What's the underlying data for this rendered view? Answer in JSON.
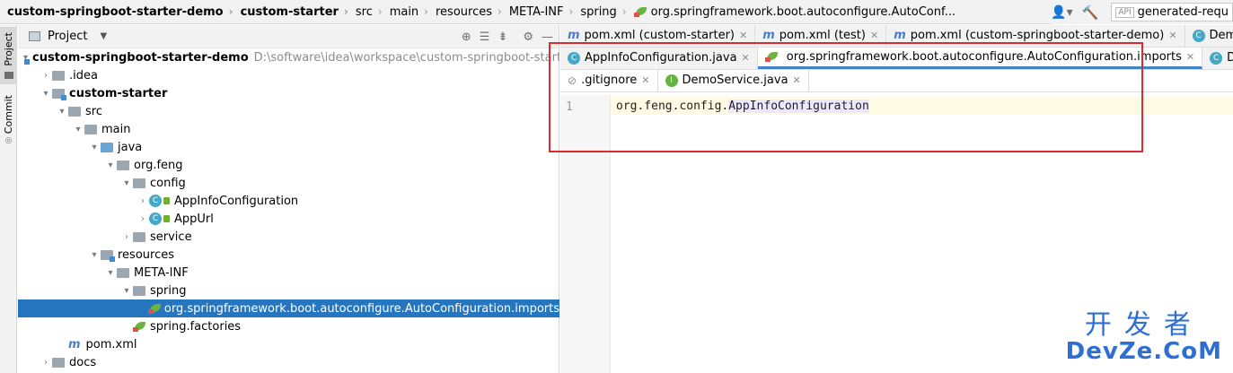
{
  "breadcrumb": [
    "custom-springboot-starter-demo",
    "custom-starter",
    "src",
    "main",
    "resources",
    "META-INF",
    "spring",
    "org.springframework.boot.autoconfigure.AutoConf..."
  ],
  "toolbar": {
    "run_config": "generated-requ"
  },
  "stripe": {
    "project": "Project",
    "commit": "Commit"
  },
  "project_panel": {
    "title": "Project",
    "tree": [
      {
        "label": "custom-springboot-starter-demo",
        "path": "D:\\software\\idea\\workspace\\custom-springboot-starter-demo",
        "indent": 0,
        "arrow": "▾",
        "icon": "module",
        "bold": true
      },
      {
        "label": ".idea",
        "indent": 1,
        "arrow": "›",
        "icon": "folder"
      },
      {
        "label": "custom-starter",
        "indent": 1,
        "arrow": "▾",
        "icon": "module",
        "bold": true
      },
      {
        "label": "src",
        "indent": 2,
        "arrow": "▾",
        "icon": "folder"
      },
      {
        "label": "main",
        "indent": 3,
        "arrow": "▾",
        "icon": "folder"
      },
      {
        "label": "java",
        "indent": 4,
        "arrow": "▾",
        "icon": "folder-blue"
      },
      {
        "label": "org.feng",
        "indent": 5,
        "arrow": "▾",
        "icon": "folder"
      },
      {
        "label": "config",
        "indent": 6,
        "arrow": "▾",
        "icon": "folder"
      },
      {
        "label": "AppInfoConfiguration",
        "indent": 7,
        "arrow": "›",
        "icon": "class"
      },
      {
        "label": "AppUrl",
        "indent": 7,
        "arrow": "›",
        "icon": "class"
      },
      {
        "label": "service",
        "indent": 6,
        "arrow": "›",
        "icon": "folder"
      },
      {
        "label": "resources",
        "indent": 4,
        "arrow": "▾",
        "icon": "folder-res"
      },
      {
        "label": "META-INF",
        "indent": 5,
        "arrow": "▾",
        "icon": "folder"
      },
      {
        "label": "spring",
        "indent": 6,
        "arrow": "▾",
        "icon": "folder"
      },
      {
        "label": "org.springframework.boot.autoconfigure.AutoConfiguration.imports",
        "indent": 7,
        "arrow": "",
        "icon": "spring",
        "selected": true
      },
      {
        "label": "spring.factories",
        "indent": 6,
        "arrow": "",
        "icon": "spring"
      },
      {
        "label": "pom.xml",
        "indent": 2,
        "arrow": "",
        "icon": "maven"
      },
      {
        "label": "docs",
        "indent": 1,
        "arrow": "›",
        "icon": "folder"
      }
    ]
  },
  "tabs_row1": [
    {
      "label": "pom.xml (custom-starter)",
      "icon": "m"
    },
    {
      "label": "pom.xml (test)",
      "icon": "m"
    },
    {
      "label": "pom.xml (custom-springboot-starter-demo)",
      "icon": "m"
    },
    {
      "label": "DemoControlle",
      "icon": "c"
    }
  ],
  "tabs_row2": [
    {
      "label": "AppInfoConfiguration.java",
      "icon": "c"
    },
    {
      "label": "org.springframework.boot.autoconfigure.AutoConfiguration.imports",
      "icon": "spring",
      "active": true
    },
    {
      "label": "DemoService",
      "icon": "c"
    }
  ],
  "tabs_row3": [
    {
      "label": ".gitignore",
      "icon": "g"
    },
    {
      "label": "DemoService.java",
      "icon": "i"
    }
  ],
  "editor": {
    "line_number": "1",
    "code_prefix": "org.feng.config.",
    "code_highlight": "AppInfoConfiguration"
  },
  "watermark": {
    "line1": "开发者",
    "line2": "DevZe.CoM"
  },
  "colors": {
    "selection": "#2675bf",
    "highlight_box": "#e0282f",
    "accent": "#4083c9"
  }
}
